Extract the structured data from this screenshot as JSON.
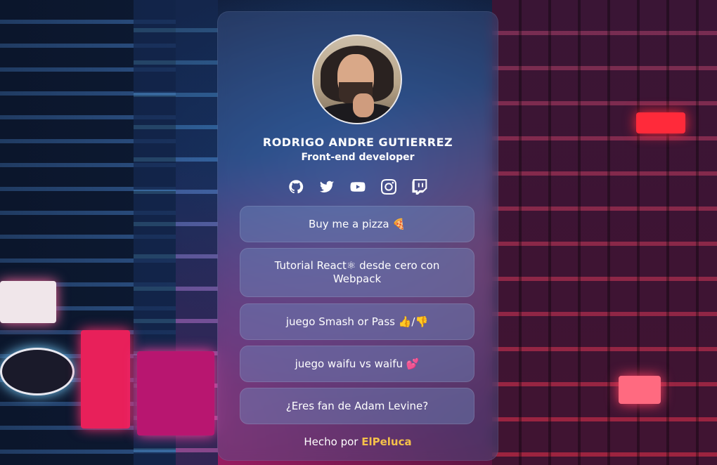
{
  "profile": {
    "name": "RODRIGO ANDRE GUTIERREZ",
    "role": "Front-end developer"
  },
  "social_icons": [
    "github-icon",
    "twitter-icon",
    "youtube-icon",
    "instagram-icon",
    "twitch-icon"
  ],
  "links": [
    {
      "label": "Buy me a pizza 🍕"
    },
    {
      "label": "Tutorial React⚛ desde cero con Webpack"
    },
    {
      "label": "juego Smash or Pass 👍/👎"
    },
    {
      "label": "juego waifu vs waifu 💕"
    },
    {
      "label": "¿Eres fan de Adam Levine?"
    }
  ],
  "footer": {
    "prefix": "Hecho por",
    "author": "ElPeluca"
  },
  "colors": {
    "text": "#ffffff",
    "footer_link": "#f4c04a",
    "card_background": "rgba(70,95,150,0.38)"
  }
}
